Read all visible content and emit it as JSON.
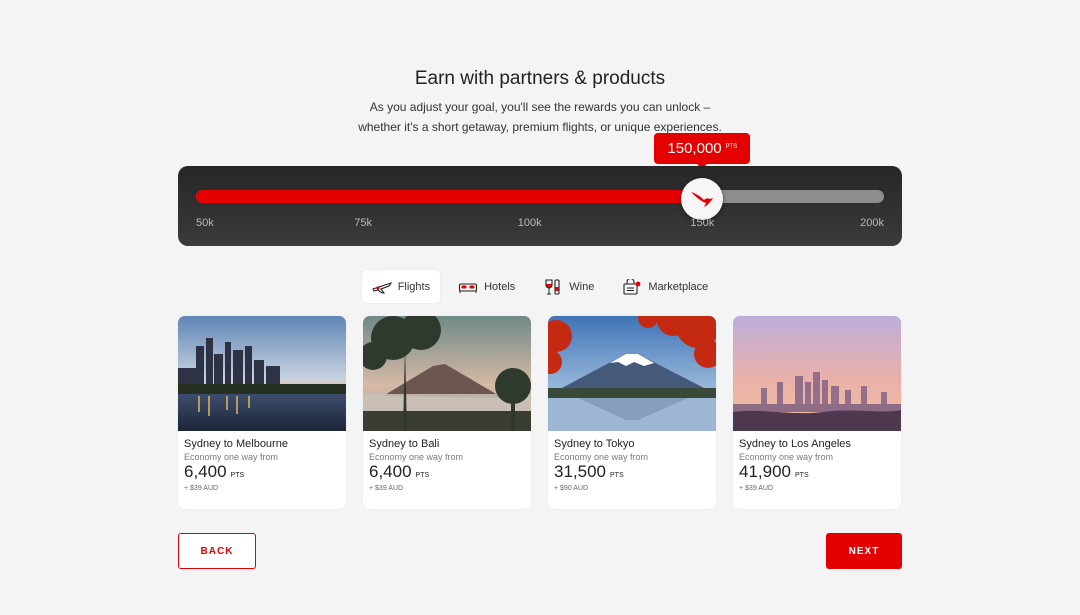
{
  "header": {
    "title": "Earn with partners & products",
    "subtitle_line1": "As you adjust your goal, you'll see the rewards you can unlock –",
    "subtitle_line2": "whether it's a short getaway, premium flights, or unique experiences."
  },
  "slider": {
    "value_label": "150,000",
    "unit_label": "PTS",
    "value": 150000,
    "min": 50000,
    "max": 200000,
    "ticks": [
      "50k",
      "75k",
      "100k",
      "150k",
      "200k"
    ],
    "tick_values": [
      50000,
      75000,
      100000,
      150000,
      200000
    ]
  },
  "tabs": [
    {
      "label": "Flights",
      "icon": "plane-icon",
      "active": true
    },
    {
      "label": "Hotels",
      "icon": "bed-icon",
      "active": false
    },
    {
      "label": "Wine",
      "icon": "wine-icon",
      "active": false
    },
    {
      "label": "Marketplace",
      "icon": "shopping-bag-icon",
      "active": false
    }
  ],
  "cards": [
    {
      "route": "Sydney to Melbourne",
      "fare": "Economy one way from",
      "price": "6,400",
      "unit": "PTS",
      "tax": "+ $39 AUD"
    },
    {
      "route": "Sydney to Bali",
      "fare": "Economy one way from",
      "price": "6,400",
      "unit": "PTS",
      "tax": "+ $39 AUD"
    },
    {
      "route": "Sydney to Tokyo",
      "fare": "Economy one way from",
      "price": "31,500",
      "unit": "PTS",
      "tax": "+ $90 AUD"
    },
    {
      "route": "Sydney to Los Angeles",
      "fare": "Economy one way from",
      "price": "41,900",
      "unit": "PTS",
      "tax": "+ $39 AUD"
    }
  ],
  "buttons": {
    "back": "BACK",
    "next": "NEXT"
  },
  "colors": {
    "brand_red": "#e40000",
    "panel_dark": "#2b2b2b",
    "background": "#f4f4f4"
  }
}
